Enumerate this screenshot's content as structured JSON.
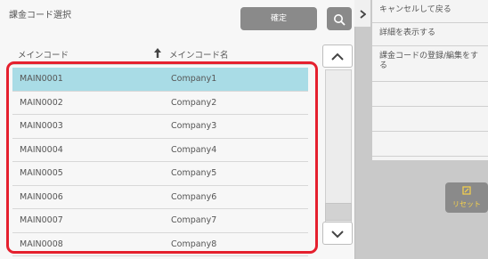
{
  "header": {
    "title": "課金コード選択",
    "confirm_label": "確定",
    "search_icon": "search-icon"
  },
  "table": {
    "col_code": "メインコード",
    "col_name": "メインコード名",
    "rows": [
      {
        "code": "MAIN0001",
        "name": "Company1"
      },
      {
        "code": "MAIN0002",
        "name": "Company2"
      },
      {
        "code": "MAIN0003",
        "name": "Company3"
      },
      {
        "code": "MAIN0004",
        "name": "Company4"
      },
      {
        "code": "MAIN0005",
        "name": "Company5"
      },
      {
        "code": "MAIN0006",
        "name": "Company6"
      },
      {
        "code": "MAIN0007",
        "name": "Company7"
      },
      {
        "code": "MAIN0008",
        "name": "Company8"
      }
    ]
  },
  "side": {
    "items": [
      "キャンセルして戻る",
      "詳細を表示する",
      "課金コードの登録/編集をする"
    ],
    "reset_label": "リセット"
  },
  "colors": {
    "selected_row": "#a9dce6",
    "highlight": "#e5202e",
    "button": "#8a8a8a"
  }
}
